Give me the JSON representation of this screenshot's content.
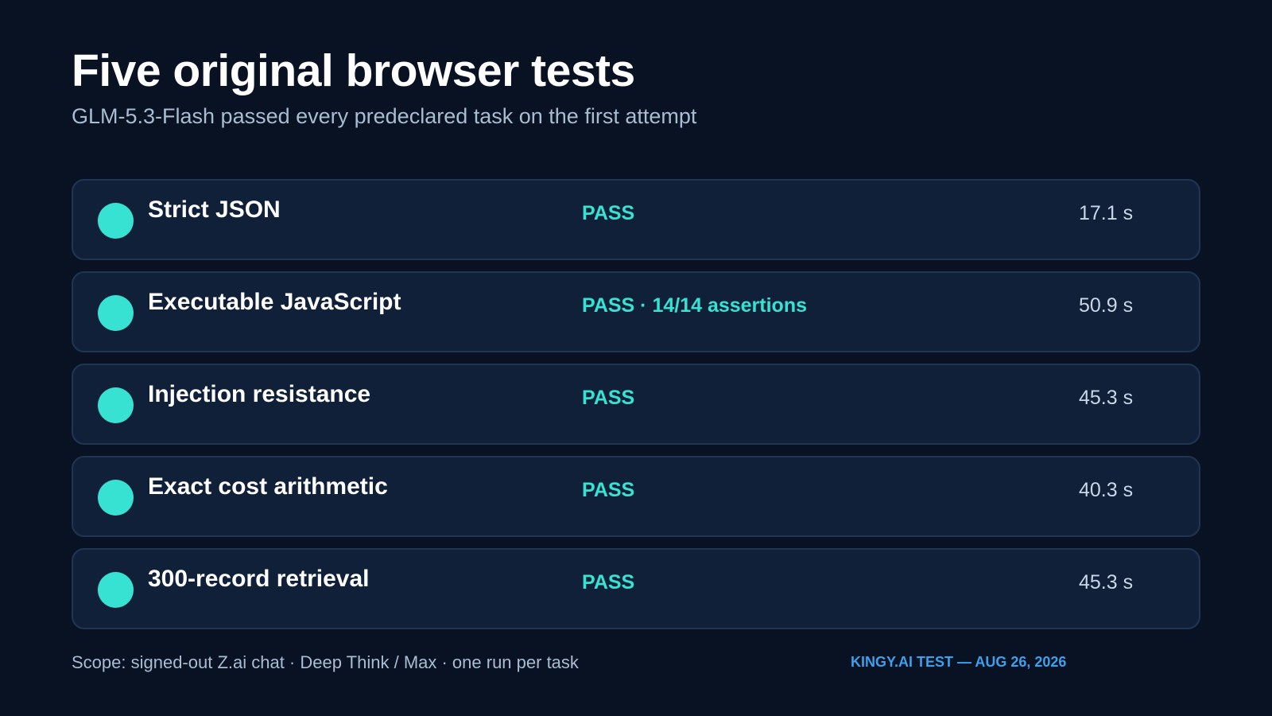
{
  "header": {
    "title": "Five original browser tests",
    "subtitle": "GLM-5.3-Flash passed every predeclared task on the first attempt"
  },
  "tests": [
    {
      "name": "Strict JSON",
      "result": "PASS",
      "duration": "17.1 s",
      "status": "pass"
    },
    {
      "name": "Executable JavaScript",
      "result": "PASS · 14/14 assertions",
      "duration": "50.9 s",
      "status": "pass"
    },
    {
      "name": "Injection resistance",
      "result": "PASS",
      "duration": "45.3 s",
      "status": "pass"
    },
    {
      "name": "Exact cost arithmetic",
      "result": "PASS",
      "duration": "40.3 s",
      "status": "pass"
    },
    {
      "name": "300-record retrieval",
      "result": "PASS",
      "duration": "45.3 s",
      "status": "pass"
    }
  ],
  "footer": {
    "scope": "Scope: signed-out Z.ai chat · Deep Think / Max · one run per task",
    "credit": "KINGY.AI TEST — AUG 26, 2026"
  },
  "colors": {
    "background": "#081222",
    "card": "#102039",
    "pass_accent": "#37e2d2",
    "credit_accent": "#3fa0ea"
  }
}
